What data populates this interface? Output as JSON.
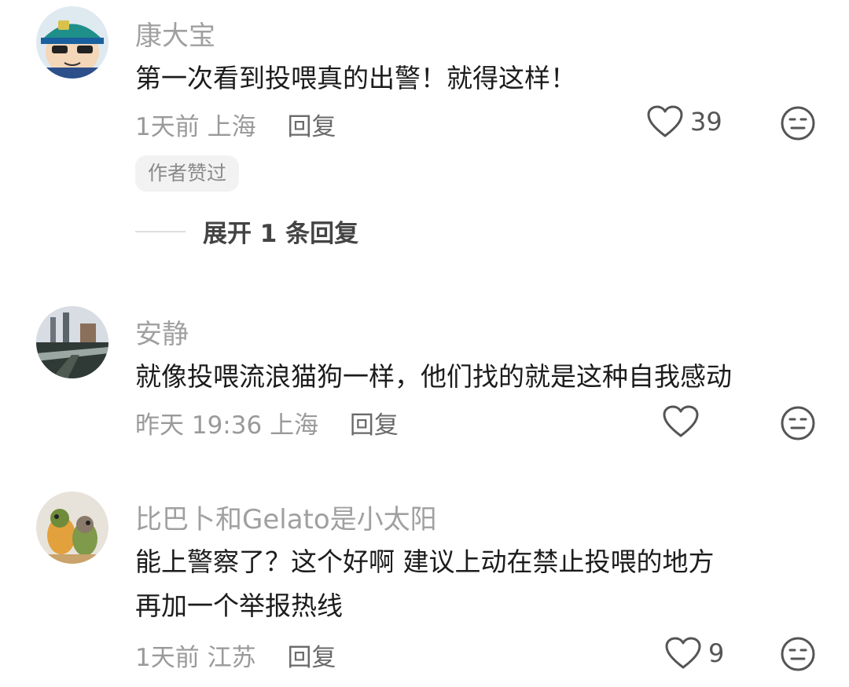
{
  "comments": [
    {
      "username": "康大宝",
      "text_lines": [
        "第一次看到投喂真的出警！就得这样！"
      ],
      "time": "1天前",
      "location": "上海",
      "reply_label": "回复",
      "likes": "39",
      "badge": "作者赞过",
      "expand_label": "展开 1 条回复",
      "avatar_icon": "cartoon-police-avatar"
    },
    {
      "username": "安静",
      "text_lines": [
        "就像投喂流浪猫狗一样，他们找的就是这种自我感动"
      ],
      "time": "昨天 19:36",
      "location": "上海",
      "reply_label": "回复",
      "likes": "",
      "avatar_icon": "city-skyline-avatar"
    },
    {
      "username": "比巴卜和Gelato是小太阳",
      "text_lines": [
        "能上警察了？这个好啊 建议上动在禁止投喂的地方",
        "再加一个举报热线"
      ],
      "time": "1天前",
      "location": "江苏",
      "reply_label": "回复",
      "likes": "9",
      "avatar_icon": "parrots-avatar"
    }
  ],
  "colors": {
    "username": "#a0a0a0",
    "text": "#1c1c1c",
    "meta": "#9a9a9a",
    "badge_bg": "#f2f2f2"
  }
}
